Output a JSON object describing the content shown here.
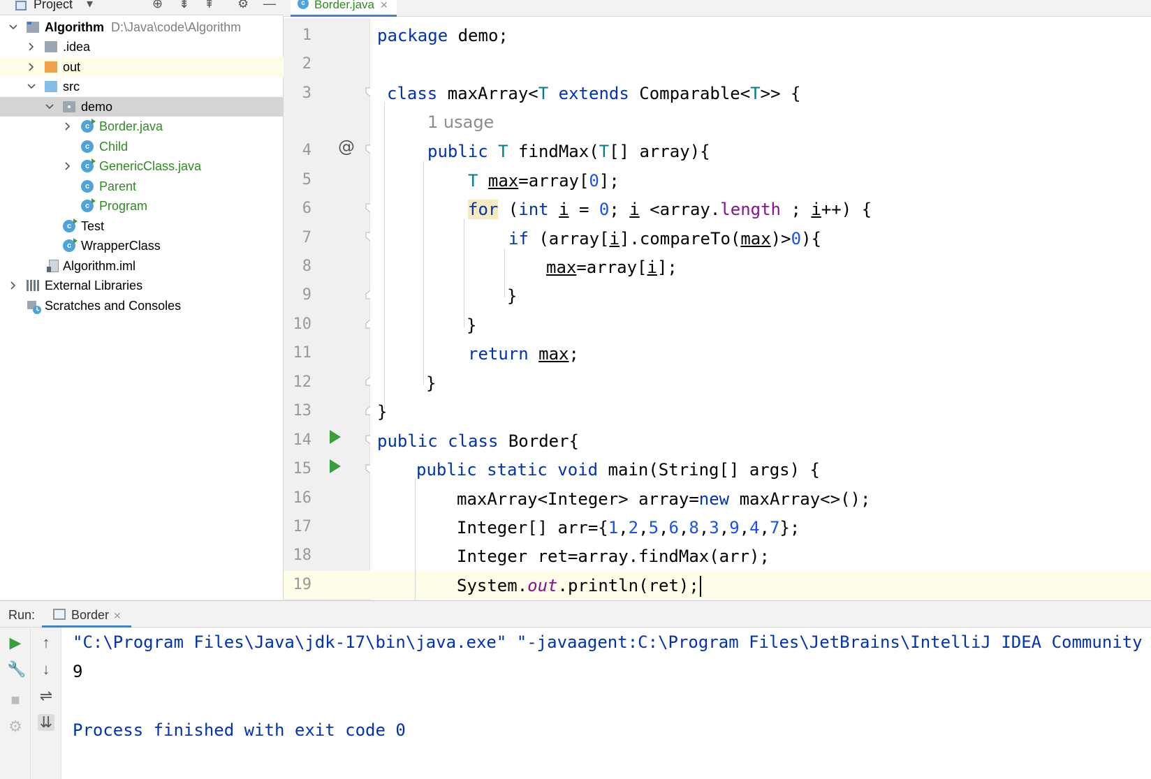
{
  "project_panel": {
    "title": "Project",
    "tree": [
      {
        "label": "Algorithm",
        "path": "D:\\Java\\code\\Algorithm"
      },
      {
        "label": ".idea"
      },
      {
        "label": "out"
      },
      {
        "label": "src"
      },
      {
        "label": "demo"
      },
      {
        "label": "Border.java"
      },
      {
        "label": "Child"
      },
      {
        "label": "GenericClass.java"
      },
      {
        "label": "Parent"
      },
      {
        "label": "Program"
      },
      {
        "label": "Test"
      },
      {
        "label": "WrapperClass"
      },
      {
        "label": "Algorithm.iml"
      },
      {
        "label": "External Libraries"
      },
      {
        "label": "Scratches and Consoles"
      }
    ]
  },
  "editor": {
    "tab_label": "Border.java",
    "line_numbers": [
      "1",
      "2",
      "3",
      "4",
      "5",
      "6",
      "7",
      "8",
      "9",
      "10",
      "11",
      "12",
      "13",
      "14",
      "15",
      "16",
      "17",
      "18",
      "19"
    ],
    "usage_hint": "1 usage",
    "code": {
      "l1": {
        "kw": "package",
        "rest": " demo;"
      },
      "l3": {
        "kw1": "class",
        "name": " maxArray<",
        "t1": "T",
        "kw2": " extends",
        "name2": " Comparable<",
        "t2": "T",
        "end": ">> {"
      },
      "l4": {
        "kw": "public",
        "t": " T",
        "rest1": " findMax(",
        "t2": "T",
        "rest2": "[] array){"
      },
      "l5": {
        "t": "T",
        "sp": " ",
        "var": "max",
        "rest": "=array[",
        "num": "0",
        "end": "];"
      },
      "l6": {
        "kw": "for",
        "p1": " (",
        "kw2": "int",
        "sp": " ",
        "v1": "i",
        "p2": " = ",
        "num": "0",
        "p3": "; ",
        "v2": "i",
        "p4": " <array.",
        "fld": "length",
        "p5": " ; ",
        "v3": "i",
        "p6": "++) {"
      },
      "l7": {
        "kw": "if",
        "p1": " (array[",
        "v1": "i",
        "p2": "].compareTo(",
        "v2": "max",
        "p3": ")>",
        "num": "0",
        "p4": "){"
      },
      "l8": {
        "v1": "max",
        "p1": "=array[",
        "v2": "i",
        "p2": "];"
      },
      "l9": "}",
      "l10": "}",
      "l11": {
        "kw": "return",
        "sp": " ",
        "v": "max",
        "end": ";"
      },
      "l12": "}",
      "l13": "}",
      "l14": {
        "kw": "public class",
        "rest": " Border{"
      },
      "l15": {
        "kw": "public static void",
        "rest": " main(String[] args) {"
      },
      "l16": {
        "p1": "maxArray<Integer> array=",
        "kw": "new",
        "p2": " maxArray<>();"
      },
      "l17": {
        "p1": "Integer[] arr={",
        "n1": "1",
        "c1": ",",
        "n2": "2",
        "c2": ",",
        "n3": "5",
        "c3": ",",
        "n4": "6",
        "c4": ",",
        "n5": "8",
        "c5": ",",
        "n6": "3",
        "c6": ",",
        "n7": "9",
        "c7": ",",
        "n8": "4",
        "c8": ",",
        "n9": "7",
        "end": "};"
      },
      "l18": "Integer ret=array.findMax(arr);",
      "l19": {
        "p1": "System.",
        "fld": "out",
        "p2": ".println(ret);"
      }
    }
  },
  "run_panel": {
    "label": "Run:",
    "tab_label": "Border",
    "console": {
      "command": "\"C:\\Program Files\\Java\\jdk-17\\bin\\java.exe\" \"-javaagent:C:\\Program Files\\JetBrains\\IntelliJ IDEA Community",
      "output": "9",
      "exit": "Process finished with exit code 0"
    }
  },
  "colors": {
    "keyword": "#0033b3",
    "type_param": "#007e8a",
    "number": "#1750eb",
    "field": "#871094",
    "current_line": "#fefde7",
    "run_green": "#3a9e3a"
  }
}
